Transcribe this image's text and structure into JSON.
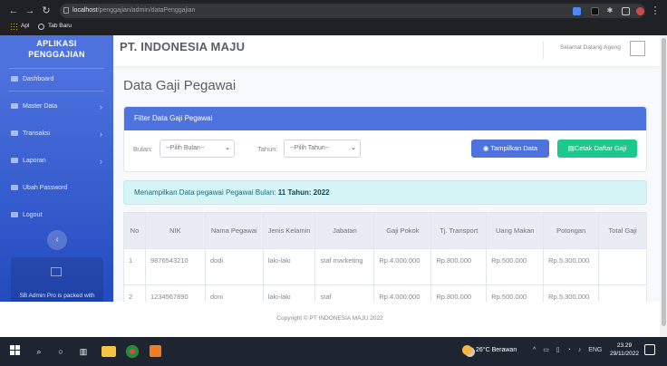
{
  "browser": {
    "url_host": "localhost",
    "url_path": "/penggajian/admin/dataPenggajian",
    "bookmarks": [
      "Apl",
      "Tab Baru"
    ]
  },
  "sidebar": {
    "brand_line1": "APLIKASI",
    "brand_line2": "PENGGAJIAN",
    "items": [
      {
        "label": "Dashboard",
        "icon": "dashboard-icon",
        "has_chevron": false
      },
      {
        "label": "Master Data",
        "icon": "folder-icon",
        "has_chevron": true
      },
      {
        "label": "Transaksi",
        "icon": "money-icon",
        "has_chevron": true
      },
      {
        "label": "Laporan",
        "icon": "report-icon",
        "has_chevron": true
      },
      {
        "label": "Ubah Password",
        "icon": "lock-icon",
        "has_chevron": false
      },
      {
        "label": "Logout",
        "icon": "logout-icon",
        "has_chevron": false
      }
    ],
    "toggle_glyph": "‹",
    "promo_text": "SB Admin Pro is packed with"
  },
  "topbar": {
    "company": "PT. INDONESIA MAJU",
    "greeting": "Selamat Datang Ageng"
  },
  "page_title": "Data Gaji Pegawai",
  "filter": {
    "header": "Filter Data Gaji Pegawai",
    "bulan_label": "Bulan:",
    "bulan_placeholder": "--Pilih Bulan--",
    "tahun_label": "Tahun:",
    "tahun_placeholder": "--Pilih Tahun--",
    "show_button": "Tampilkan Data",
    "print_button": "Cetak Daftar Gaji"
  },
  "alert": {
    "prefix": "Menampilkan Data pegawai Pegawai Bulan:",
    "bulan": "11",
    "tahun_label": "Tahun:",
    "tahun": "2022"
  },
  "table": {
    "headers": [
      "No",
      "NIK",
      "Nama Pegawai",
      "Jenis Kelamin",
      "Jabatan",
      "Gaji Pokok",
      "Tj. Transport",
      "Uang Makan",
      "Potongan",
      "Total Gaji"
    ],
    "rows": [
      [
        "1",
        "9876543210",
        "dodi",
        "laki-laki",
        "staf marketing",
        "Rp.4.000.000",
        "Rp.800.000",
        "Rp.500.000",
        "Rp.5.300.000",
        ""
      ],
      [
        "2",
        "1234567890",
        "doni",
        "laki-laki",
        "staf",
        "Rp.4.000.000",
        "Rp.800.000",
        "Rp.500.000",
        "Rp.5.300.000",
        ""
      ]
    ]
  },
  "footer": "Copyright © PT INDONESIA MAJU 2022",
  "taskbar": {
    "weather": "26°C  Berawan",
    "lang": "ENG",
    "time": "23.29",
    "date": "29/11/2022"
  },
  "colors": {
    "primary": "#4e73df",
    "success": "#1cc88a",
    "info_bg": "#d4f4f6"
  }
}
